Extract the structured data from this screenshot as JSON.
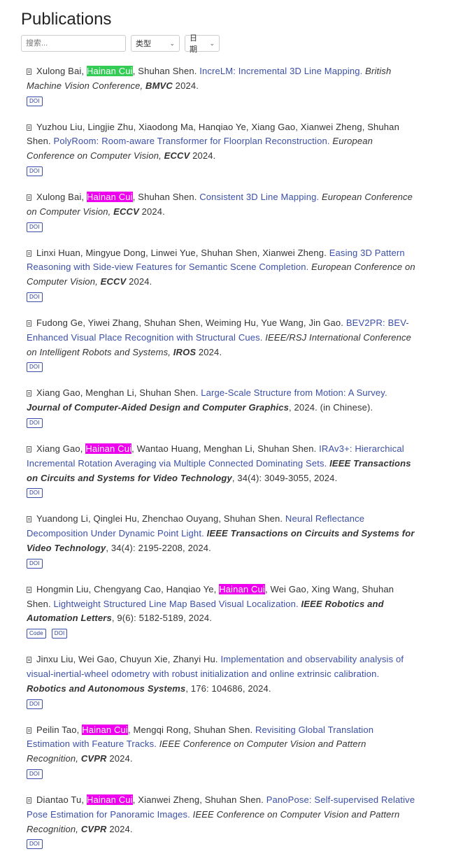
{
  "page": {
    "title": "Publications"
  },
  "filters": {
    "search_placeholder": "搜索...",
    "type_label": "类型",
    "date_label": "日期"
  },
  "colors": {
    "highlight_green": "#33cc55",
    "highlight_magenta": "#ee00ee",
    "link": "#3a4fa8"
  },
  "publications": [
    {
      "authors": [
        {
          "t": "Xulong Bai, "
        },
        {
          "t": "Hainan Cui",
          "hl": "green"
        },
        {
          "t": ", Shuhan Shen. "
        }
      ],
      "title": "IncreLM: Incremental 3D Line Mapping.",
      "venue_pre": "British Machine Vision Conference, ",
      "abbr": "BMVC",
      "tail": " 2024.",
      "badges": [
        "DOI"
      ]
    },
    {
      "authors": [
        {
          "t": "Yuzhou Liu, Lingjie Zhu, Xiaodong Ma, Hanqiao Ye, Xiang Gao, Xianwei Zheng, Shuhan Shen. "
        }
      ],
      "title": "PolyRoom: Room-aware Transformer for Floorplan Reconstruction.",
      "venue_pre": "European Conference on Computer Vision, ",
      "abbr": "ECCV",
      "tail": " 2024.",
      "badges": [
        "DOI"
      ]
    },
    {
      "authors": [
        {
          "t": "Xulong Bai, "
        },
        {
          "t": "Hainan Cui",
          "hl": "magenta"
        },
        {
          "t": ", Shuhan Shen. "
        }
      ],
      "title": "Consistent 3D Line Mapping.",
      "venue_pre": "European Conference on Computer Vision, ",
      "abbr": "ECCV",
      "tail": " 2024.",
      "badges": [
        "DOI"
      ]
    },
    {
      "authors": [
        {
          "t": "Linxi Huan, Mingyue Dong, Linwei Yue, Shuhan Shen, Xianwei Zheng. "
        }
      ],
      "title": "Easing 3D Pattern Reasoning with Side-view Features for Semantic Scene Completion.",
      "venue_pre": "European Conference on Computer Vision, ",
      "abbr": "ECCV",
      "tail": " 2024.",
      "badges": [
        "DOI"
      ]
    },
    {
      "authors": [
        {
          "t": "Fudong Ge, Yiwei Zhang, Shuhan Shen, Weiming Hu, Yue Wang, Jin Gao. "
        }
      ],
      "title": "BEV2PR: BEV-Enhanced Visual Place Recognition with Structural Cues.",
      "venue_pre": "IEEE/RSJ International Conference on Intelligent Robots and Systems, ",
      "abbr": "IROS",
      "tail": " 2024.",
      "badges": [
        "DOI"
      ]
    },
    {
      "authors": [
        {
          "t": "Xiang Gao, Menghan Li, Shuhan Shen. "
        }
      ],
      "title": "Large-Scale Structure from Motion: A Survey.",
      "venue_pre": "",
      "abbr": "Journal of Computer-Aided Design and Computer Graphics",
      "tail": ", 2024. (in Chinese).",
      "badges": [
        "DOI"
      ]
    },
    {
      "authors": [
        {
          "t": "Xiang Gao, "
        },
        {
          "t": "Hainan Cui",
          "hl": "magenta"
        },
        {
          "t": ", Wantao Huang, Menghan Li, Shuhan Shen. "
        }
      ],
      "title": "IRAv3+: Hierarchical Incremental Rotation Averaging via Multiple Connected Dominating Sets.",
      "venue_pre": "",
      "abbr": "IEEE Transactions on Circuits and Systems for Video Technology",
      "tail": ", 34(4): 3049-3055, 2024.",
      "badges": [
        "DOI"
      ]
    },
    {
      "authors": [
        {
          "t": "Yuandong Li, Qinglei Hu, Zhenchao Ouyang, Shuhan Shen. "
        }
      ],
      "title": "Neural Reflectance Decomposition Under Dynamic Point Light.",
      "venue_pre": "",
      "abbr": "IEEE Transactions on Circuits and Systems for Video Technology",
      "tail": ", 34(4): 2195-2208, 2024.",
      "badges": [
        "DOI"
      ]
    },
    {
      "authors": [
        {
          "t": "Hongmin Liu, Chengyang Cao, Hanqiao Ye, "
        },
        {
          "t": "Hainan Cui",
          "hl": "magenta"
        },
        {
          "t": ", Wei Gao, Xing Wang, Shuhan Shen. "
        }
      ],
      "title": "Lightweight Structured Line Map Based Visual Localization.",
      "venue_pre": "",
      "abbr": "IEEE Robotics and Automation Letters",
      "tail": ", 9(6): 5182-5189, 2024.",
      "badges": [
        "Code",
        "DOI"
      ]
    },
    {
      "authors": [
        {
          "t": "Jinxu Liu, Wei Gao, Chuyun Xie, Zhanyi Hu. "
        }
      ],
      "title": "Implementation and observability analysis of visual-inertial-wheel odometry with robust initialization and online extrinsic calibration.",
      "venue_pre": "",
      "abbr": "Robotics and Autonomous Systems",
      "tail": ", 176: 104686, 2024.",
      "badges": [
        "DOI"
      ]
    },
    {
      "authors": [
        {
          "t": "Peilin Tao, "
        },
        {
          "t": "Hainan Cui",
          "hl": "magenta"
        },
        {
          "t": ", Mengqi Rong, Shuhan Shen. "
        }
      ],
      "title": "Revisiting Global Translation Estimation with Feature Tracks.",
      "venue_pre": "IEEE Conference on Computer Vision and Pattern Recognition, ",
      "abbr": "CVPR",
      "tail": " 2024.",
      "badges": [
        "DOI"
      ]
    },
    {
      "authors": [
        {
          "t": "Diantao Tu, "
        },
        {
          "t": "Hainan Cui",
          "hl": "magenta"
        },
        {
          "t": ", Xianwei Zheng, Shuhan Shen. "
        }
      ],
      "title": "PanoPose: Self-supervised Relative Pose Estimation for Panoramic Images.",
      "venue_pre": "IEEE Conference on Computer Vision and Pattern Recognition, ",
      "abbr": "CVPR",
      "tail": " 2024.",
      "badges": [
        "DOI"
      ]
    }
  ]
}
